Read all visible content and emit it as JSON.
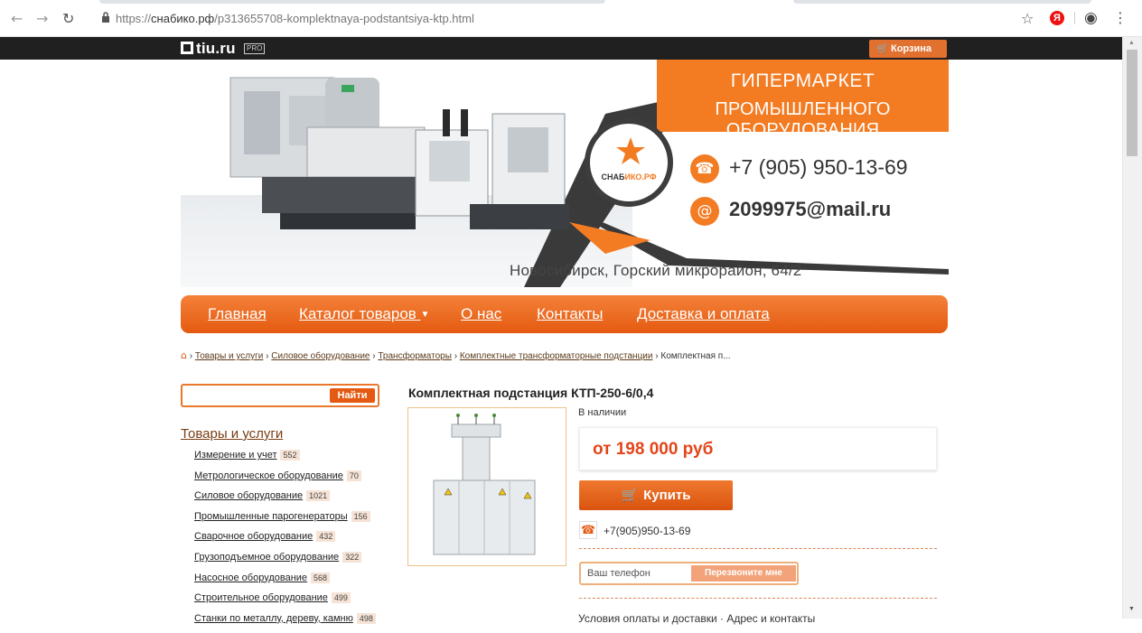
{
  "browser": {
    "back_icon": "arrow-left-icon",
    "forward_icon": "arrow-right-icon",
    "reload_icon": "reload-icon",
    "url_prefix": "https://",
    "url_host": "снабико.рф",
    "url_path": "/p313655708-komplektnaya-podstantsiya-ktp.html",
    "yandex_badge": "Я"
  },
  "topbar": {
    "logo": "tiu.ru",
    "pro_badge": "PRO",
    "cart_label": "Корзина"
  },
  "banner": {
    "tagline_line1": "ГИПЕРМАРКЕТ",
    "tagline_line2": "ПРОМЫШЛЕННОГО ОБОРУДОВАНИЯ",
    "brand_part1": "СНАБ",
    "brand_part2": "ИКО.РФ",
    "phone": "+7 (905) 950-13-69",
    "email": "2099975@mail.ru",
    "address": "Новосибирск, Горский микрорайон, 64/2",
    "accent_color": "#f37b22"
  },
  "nav": {
    "home": "Главная",
    "catalog": "Каталог товаров",
    "about": "О нас",
    "contacts": "Контакты",
    "delivery": "Доставка и оплата"
  },
  "breadcrumbs": {
    "items": [
      "Товары и услуги",
      "Силовое оборудование",
      "Трансформаторы",
      "Комплектные трансформаторные подстанции"
    ],
    "current": "Комплектная п..."
  },
  "search": {
    "placeholder": "",
    "button": "Найти"
  },
  "sidebar": {
    "title": "Товары и услуги",
    "categories": [
      {
        "label": "Измерение и учет",
        "count": "552"
      },
      {
        "label": "Метрологическое оборудование",
        "count": "70"
      },
      {
        "label": "Силовое оборудование",
        "count": "1021"
      },
      {
        "label": "Промышленные парогенераторы",
        "count": "156"
      },
      {
        "label": "Сварочное оборудование",
        "count": "432"
      },
      {
        "label": "Грузоподъемное оборудование",
        "count": "322"
      },
      {
        "label": "Насосное оборудование",
        "count": "568"
      },
      {
        "label": "Строительное оборудование",
        "count": "499"
      },
      {
        "label": "Станки по металлу, дереву, камню",
        "count": "498"
      }
    ]
  },
  "product": {
    "title": "Комплектная подстанция КТП-250-6/0,4",
    "stock": "В наличии",
    "price": "от 198 000 руб",
    "buy_button": "Купить",
    "phone": "+7(905)950-13-69",
    "callback_placeholder": "Ваш телефон",
    "callback_button": "Перезвоните мне",
    "footer_text": "Условия оплаты и доставки · Адрес и контакты"
  }
}
